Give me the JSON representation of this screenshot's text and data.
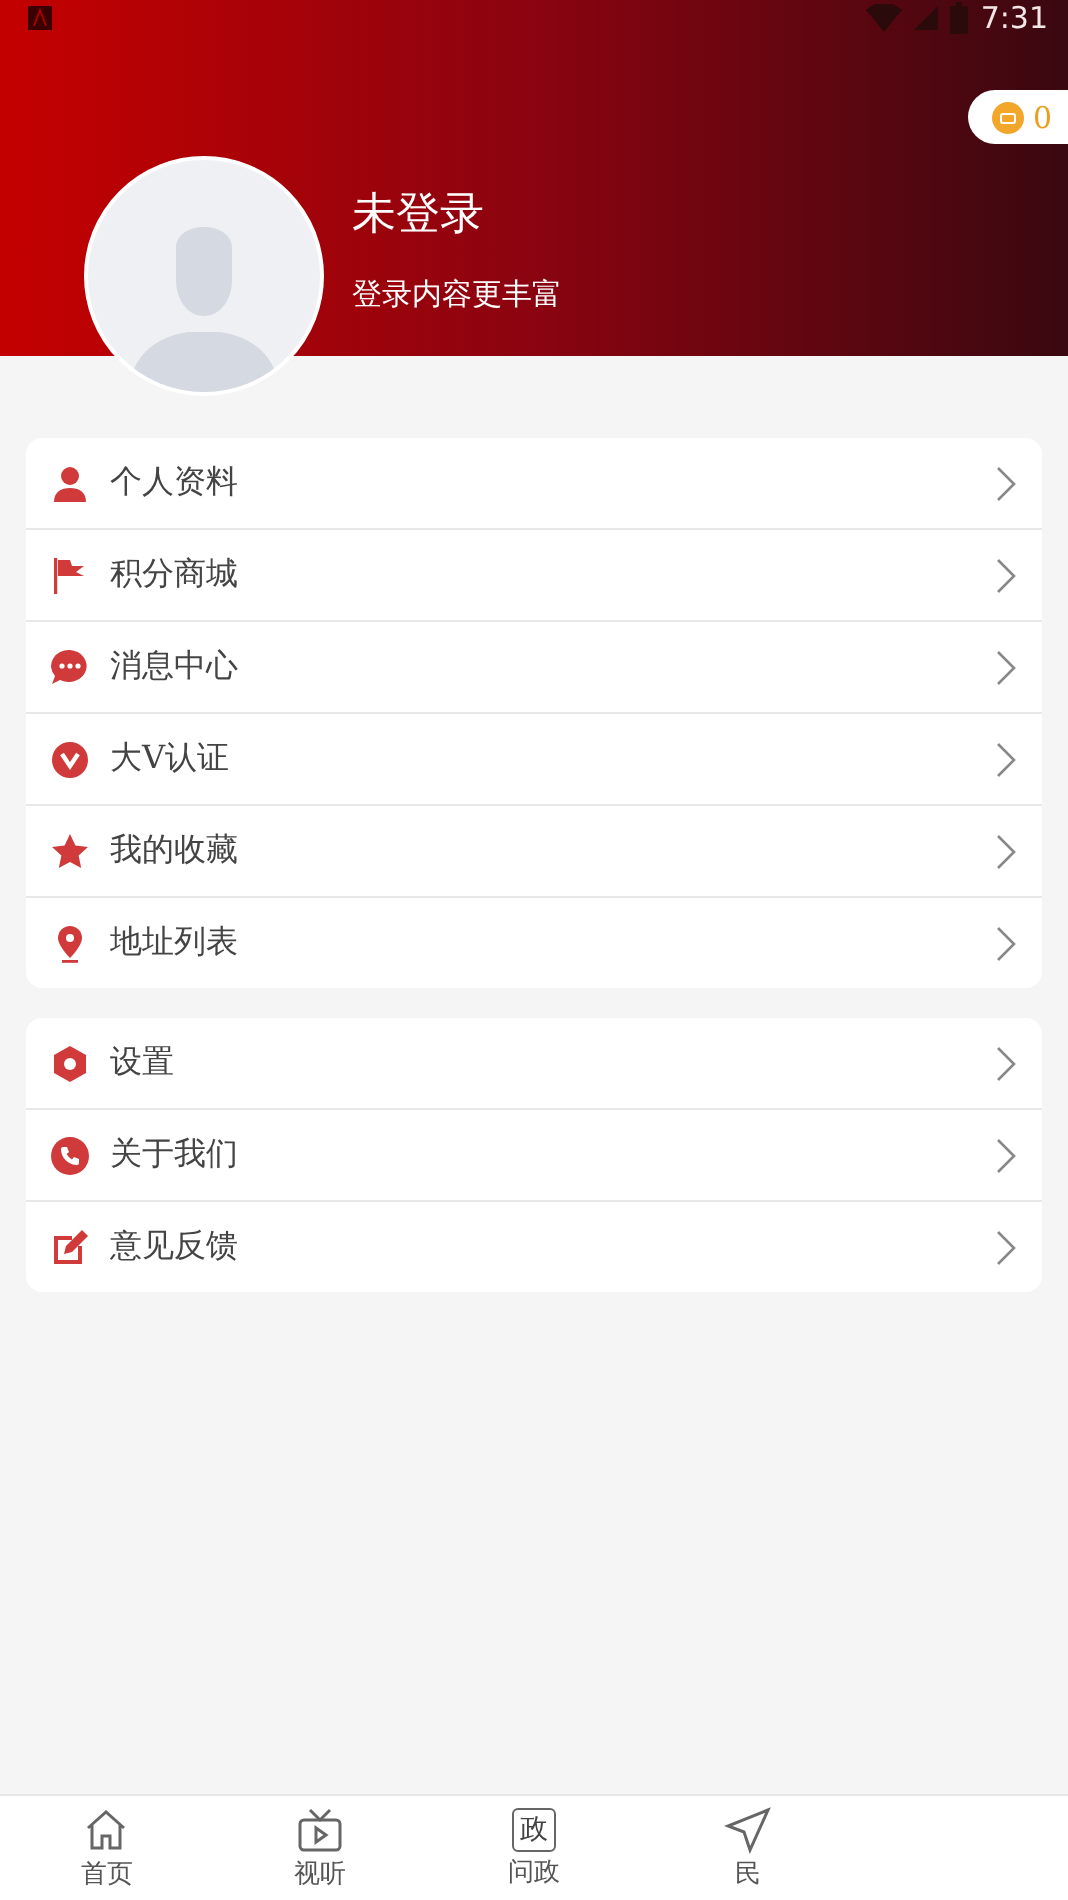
{
  "status_bar": {
    "time": "7:31"
  },
  "header": {
    "coins": "0",
    "name": "未登录",
    "subtitle": "登录内容更丰富"
  },
  "menu_groups": [
    {
      "items": [
        {
          "label": "个人资料",
          "kind": "person"
        },
        {
          "label": "积分商城",
          "kind": "flag"
        },
        {
          "label": "消息中心",
          "kind": "chat"
        },
        {
          "label": "大V认证",
          "kind": "badge"
        },
        {
          "label": "我的收藏",
          "kind": "star"
        },
        {
          "label": "地址列表",
          "kind": "pin"
        }
      ]
    },
    {
      "items": [
        {
          "label": "设置",
          "kind": "gear"
        },
        {
          "label": "关于我们",
          "kind": "phone"
        },
        {
          "label": "意见反馈",
          "kind": "edit"
        }
      ]
    }
  ],
  "tab_bar": [
    {
      "label": "首页",
      "kind": "home"
    },
    {
      "label": "视听",
      "kind": "tv"
    },
    {
      "label": "问政",
      "kind": "zheng",
      "glyph": "政"
    },
    {
      "label": "民",
      "kind": "send"
    }
  ]
}
